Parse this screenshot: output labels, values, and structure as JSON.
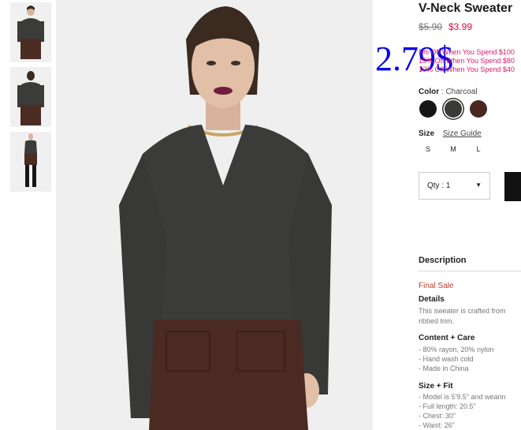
{
  "product": {
    "title": "V-Neck Sweater",
    "price_original": "$5.90",
    "price_sale": "$3.99"
  },
  "overlay_price": "2.79$",
  "promos": [
    "5% Off When You Spend $100",
    "15% Off When You Spend $80",
    "10% Off When You Spend $40"
  ],
  "color": {
    "label": "Color",
    "separator": ":",
    "value": "Charcoal",
    "swatches": [
      {
        "name": "black",
        "hex": "#161616",
        "selected": false
      },
      {
        "name": "charcoal",
        "hex": "#3a3a38",
        "selected": true
      },
      {
        "name": "brown",
        "hex": "#4a2620",
        "selected": false
      }
    ]
  },
  "size": {
    "label": "Size",
    "guide_label": "Size Guide",
    "options": [
      "S",
      "M",
      "L"
    ]
  },
  "quantity": {
    "label": "Qty : 1",
    "caret": "▼"
  },
  "description": {
    "heading": "Description",
    "final_sale": "Final Sale",
    "details_title": "Details",
    "details_lines": [
      "This sweater is crafted from",
      "ribbed trim."
    ],
    "care_title": "Content + Care",
    "care_lines": [
      "- 80% rayon, 20% nylon",
      "- Hand wash cold",
      "- Made in China"
    ],
    "fit_title": "Size + Fit",
    "fit_lines": [
      "- Model is 5'9.5\" and wearin",
      "- Full length: 20.5\"",
      "- Chest: 30\"",
      "- Waist: 26\""
    ]
  },
  "colors": {
    "sale_red": "#d0103a",
    "promo_pink": "#e0186a",
    "overlay_blue": "#0000ee",
    "final_sale_red": "#c0392b"
  }
}
